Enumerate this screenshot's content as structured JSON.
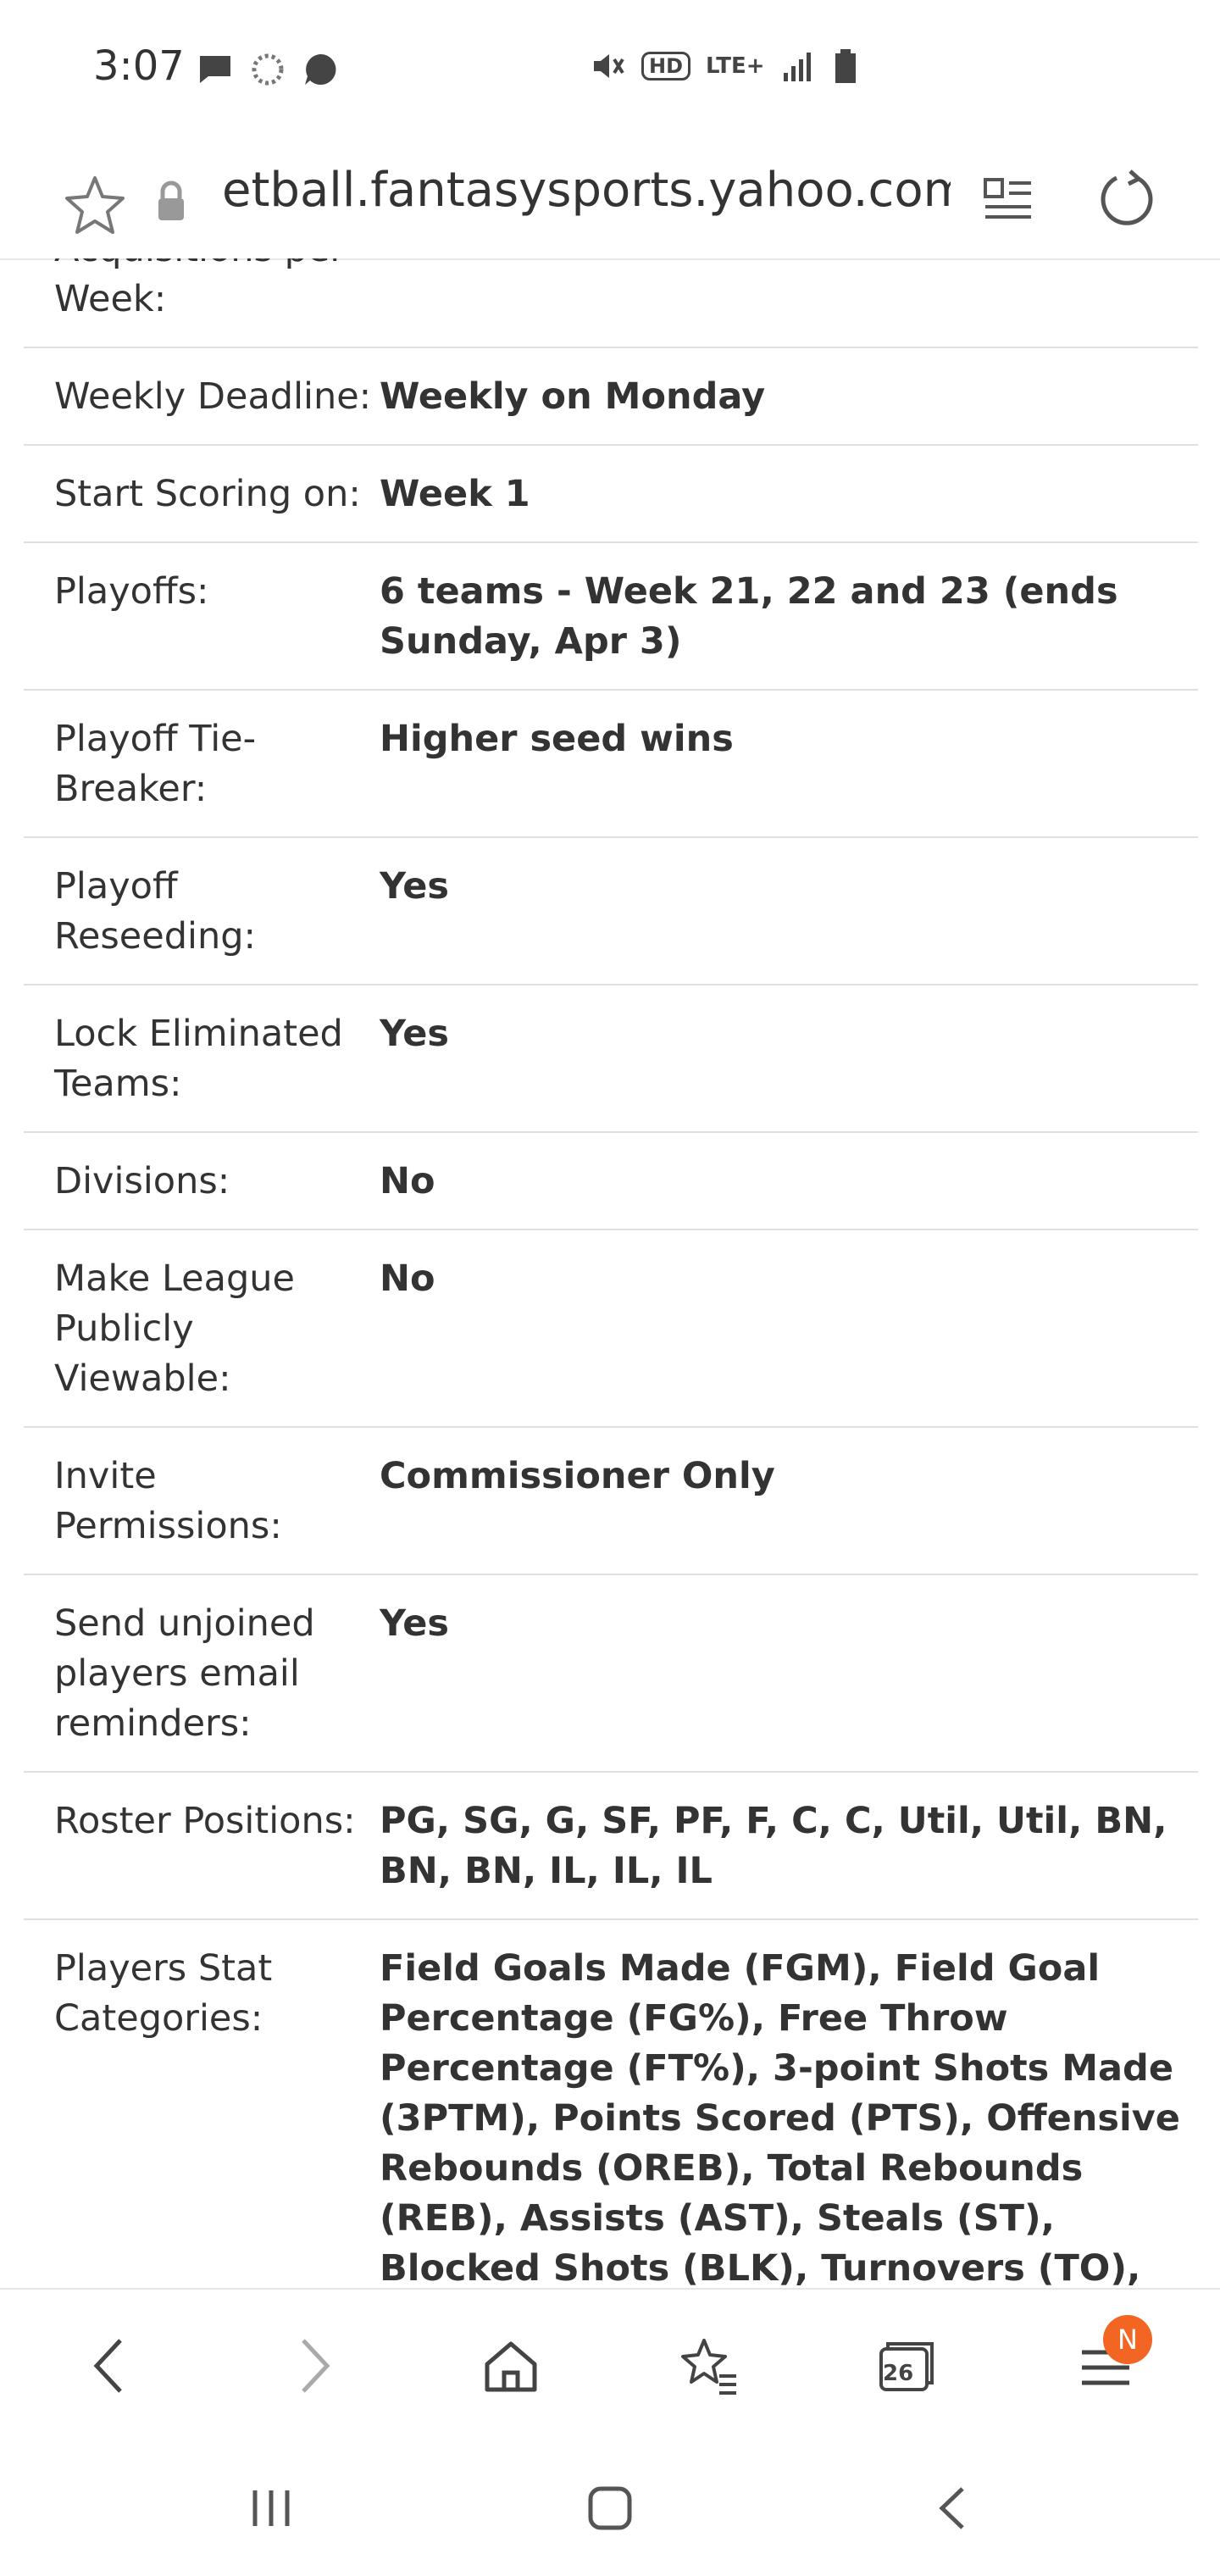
{
  "status_bar": {
    "time": "3:07",
    "left_icons": [
      "message-icon",
      "loading-icon",
      "chat-bubble-icon"
    ],
    "right_icons": [
      "mute-icon",
      "hd-icon",
      "lte-icon",
      "signal-icon",
      "battery-icon"
    ],
    "hd_label": "HD",
    "lte_label": "LTE+"
  },
  "url_bar": {
    "url": "etball.fantasysports.yahoo.com",
    "url_prefix_clip": "ʻ"
  },
  "settings_rows": [
    {
      "label": "Acquisitions per Week:",
      "value": ""
    },
    {
      "label": "Weekly Deadline:",
      "value": "Weekly on Monday"
    },
    {
      "label": "Start Scoring on:",
      "value": "Week 1"
    },
    {
      "label": "Playoffs:",
      "value": "6 teams - Week 21, 22 and 23 (ends Sunday, Apr 3)"
    },
    {
      "label": "Playoff Tie-Breaker:",
      "value": "Higher seed wins"
    },
    {
      "label": "Playoff Reseeding:",
      "value": "Yes"
    },
    {
      "label": "Lock Eliminated Teams:",
      "value": "Yes"
    },
    {
      "label": "Divisions:",
      "value": "No"
    },
    {
      "label": "Make League Publicly Viewable:",
      "value": "No"
    },
    {
      "label": "Invite Permissions:",
      "value": "Commissioner Only"
    },
    {
      "label": "Send unjoined players email reminders:",
      "value": "Yes"
    },
    {
      "label": "Roster Positions:",
      "value": "PG, SG, G, SF, PF, F, C, C, Util, Util, BN, BN, BN, IL, IL, IL"
    },
    {
      "label": "Players Stat Categories:",
      "value": "Field Goals Made (FGM), Field Goal Percentage (FG%), Free Throw Percentage (FT%), 3-point Shots Made (3PTM), Points Scored (PTS), Offensive Rebounds (OREB), Total Rebounds (REB), Assists (AST), Steals (ST), Blocked Shots (BLK), Turnovers (TO), Assist/Turnover Ratio (A/T)"
    }
  ],
  "toolbar": {
    "tabs_count": "26",
    "badge": "N"
  },
  "colors": {
    "badge": "#f26522",
    "text": "#333333",
    "divider": "#e0e0e0"
  }
}
